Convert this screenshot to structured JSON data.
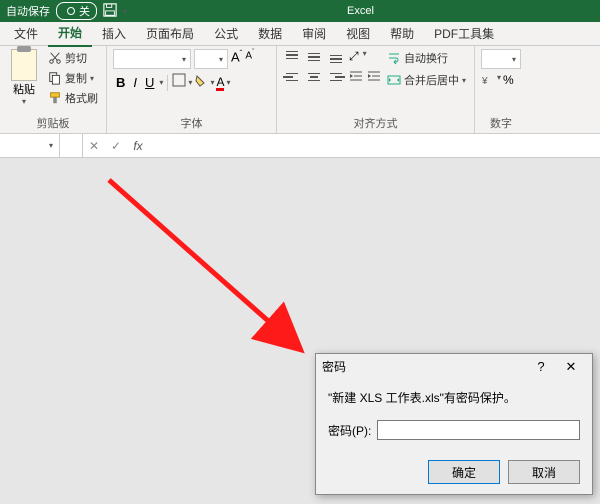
{
  "titlebar": {
    "autosave_label": "自动保存",
    "autosave_state": "关",
    "app_name": "Excel",
    "save_icon": "save-icon"
  },
  "tabs": [
    "文件",
    "开始",
    "插入",
    "页面布局",
    "公式",
    "数据",
    "审阅",
    "视图",
    "帮助",
    "PDF工具集"
  ],
  "active_tab_index": 1,
  "ribbon": {
    "clipboard": {
      "paste": "粘贴",
      "cut": "剪切",
      "copy": "复制",
      "format_painter": "格式刷",
      "group_label": "剪贴板"
    },
    "font": {
      "size_up": "A",
      "size_down": "A",
      "group_label": "字体"
    },
    "alignment": {
      "wrap_text": "自动换行",
      "merge_center": "合并后居中",
      "group_label": "对齐方式"
    },
    "number": {
      "percent": "%",
      "group_label": "数字"
    }
  },
  "formula_bar": {
    "cancel": "✕",
    "confirm": "✓",
    "fx": "fx"
  },
  "dialog": {
    "title": "密码",
    "help": "?",
    "close": "✕",
    "message": "\"新建 XLS 工作表.xls\"有密码保护。",
    "field_label": "密码(P):",
    "ok": "确定",
    "cancel": "取消"
  }
}
